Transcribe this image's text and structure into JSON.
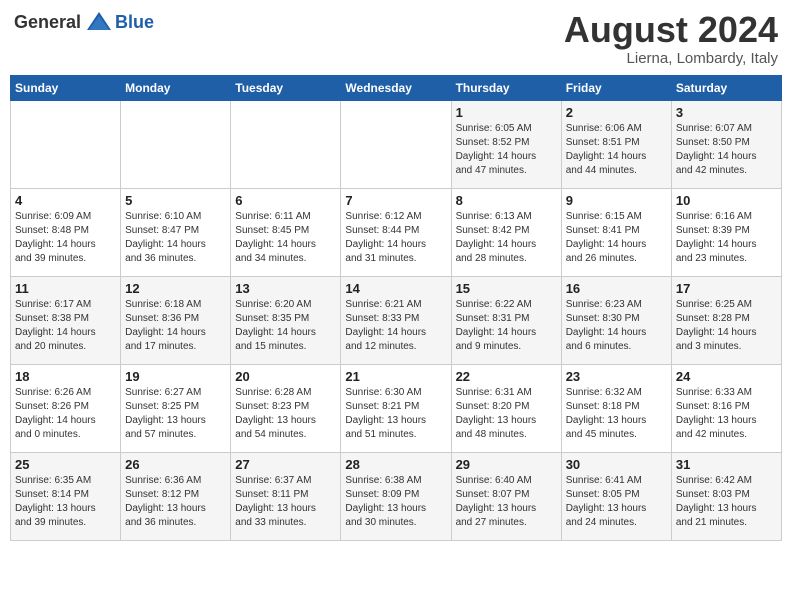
{
  "logo": {
    "general": "General",
    "blue": "Blue"
  },
  "title": {
    "month_year": "August 2024",
    "location": "Lierna, Lombardy, Italy"
  },
  "headers": [
    "Sunday",
    "Monday",
    "Tuesday",
    "Wednesday",
    "Thursday",
    "Friday",
    "Saturday"
  ],
  "weeks": [
    [
      {
        "day": "",
        "info": ""
      },
      {
        "day": "",
        "info": ""
      },
      {
        "day": "",
        "info": ""
      },
      {
        "day": "",
        "info": ""
      },
      {
        "day": "1",
        "info": "Sunrise: 6:05 AM\nSunset: 8:52 PM\nDaylight: 14 hours\nand 47 minutes."
      },
      {
        "day": "2",
        "info": "Sunrise: 6:06 AM\nSunset: 8:51 PM\nDaylight: 14 hours\nand 44 minutes."
      },
      {
        "day": "3",
        "info": "Sunrise: 6:07 AM\nSunset: 8:50 PM\nDaylight: 14 hours\nand 42 minutes."
      }
    ],
    [
      {
        "day": "4",
        "info": "Sunrise: 6:09 AM\nSunset: 8:48 PM\nDaylight: 14 hours\nand 39 minutes."
      },
      {
        "day": "5",
        "info": "Sunrise: 6:10 AM\nSunset: 8:47 PM\nDaylight: 14 hours\nand 36 minutes."
      },
      {
        "day": "6",
        "info": "Sunrise: 6:11 AM\nSunset: 8:45 PM\nDaylight: 14 hours\nand 34 minutes."
      },
      {
        "day": "7",
        "info": "Sunrise: 6:12 AM\nSunset: 8:44 PM\nDaylight: 14 hours\nand 31 minutes."
      },
      {
        "day": "8",
        "info": "Sunrise: 6:13 AM\nSunset: 8:42 PM\nDaylight: 14 hours\nand 28 minutes."
      },
      {
        "day": "9",
        "info": "Sunrise: 6:15 AM\nSunset: 8:41 PM\nDaylight: 14 hours\nand 26 minutes."
      },
      {
        "day": "10",
        "info": "Sunrise: 6:16 AM\nSunset: 8:39 PM\nDaylight: 14 hours\nand 23 minutes."
      }
    ],
    [
      {
        "day": "11",
        "info": "Sunrise: 6:17 AM\nSunset: 8:38 PM\nDaylight: 14 hours\nand 20 minutes."
      },
      {
        "day": "12",
        "info": "Sunrise: 6:18 AM\nSunset: 8:36 PM\nDaylight: 14 hours\nand 17 minutes."
      },
      {
        "day": "13",
        "info": "Sunrise: 6:20 AM\nSunset: 8:35 PM\nDaylight: 14 hours\nand 15 minutes."
      },
      {
        "day": "14",
        "info": "Sunrise: 6:21 AM\nSunset: 8:33 PM\nDaylight: 14 hours\nand 12 minutes."
      },
      {
        "day": "15",
        "info": "Sunrise: 6:22 AM\nSunset: 8:31 PM\nDaylight: 14 hours\nand 9 minutes."
      },
      {
        "day": "16",
        "info": "Sunrise: 6:23 AM\nSunset: 8:30 PM\nDaylight: 14 hours\nand 6 minutes."
      },
      {
        "day": "17",
        "info": "Sunrise: 6:25 AM\nSunset: 8:28 PM\nDaylight: 14 hours\nand 3 minutes."
      }
    ],
    [
      {
        "day": "18",
        "info": "Sunrise: 6:26 AM\nSunset: 8:26 PM\nDaylight: 14 hours\nand 0 minutes."
      },
      {
        "day": "19",
        "info": "Sunrise: 6:27 AM\nSunset: 8:25 PM\nDaylight: 13 hours\nand 57 minutes."
      },
      {
        "day": "20",
        "info": "Sunrise: 6:28 AM\nSunset: 8:23 PM\nDaylight: 13 hours\nand 54 minutes."
      },
      {
        "day": "21",
        "info": "Sunrise: 6:30 AM\nSunset: 8:21 PM\nDaylight: 13 hours\nand 51 minutes."
      },
      {
        "day": "22",
        "info": "Sunrise: 6:31 AM\nSunset: 8:20 PM\nDaylight: 13 hours\nand 48 minutes."
      },
      {
        "day": "23",
        "info": "Sunrise: 6:32 AM\nSunset: 8:18 PM\nDaylight: 13 hours\nand 45 minutes."
      },
      {
        "day": "24",
        "info": "Sunrise: 6:33 AM\nSunset: 8:16 PM\nDaylight: 13 hours\nand 42 minutes."
      }
    ],
    [
      {
        "day": "25",
        "info": "Sunrise: 6:35 AM\nSunset: 8:14 PM\nDaylight: 13 hours\nand 39 minutes."
      },
      {
        "day": "26",
        "info": "Sunrise: 6:36 AM\nSunset: 8:12 PM\nDaylight: 13 hours\nand 36 minutes."
      },
      {
        "day": "27",
        "info": "Sunrise: 6:37 AM\nSunset: 8:11 PM\nDaylight: 13 hours\nand 33 minutes."
      },
      {
        "day": "28",
        "info": "Sunrise: 6:38 AM\nSunset: 8:09 PM\nDaylight: 13 hours\nand 30 minutes."
      },
      {
        "day": "29",
        "info": "Sunrise: 6:40 AM\nSunset: 8:07 PM\nDaylight: 13 hours\nand 27 minutes."
      },
      {
        "day": "30",
        "info": "Sunrise: 6:41 AM\nSunset: 8:05 PM\nDaylight: 13 hours\nand 24 minutes."
      },
      {
        "day": "31",
        "info": "Sunrise: 6:42 AM\nSunset: 8:03 PM\nDaylight: 13 hours\nand 21 minutes."
      }
    ]
  ]
}
